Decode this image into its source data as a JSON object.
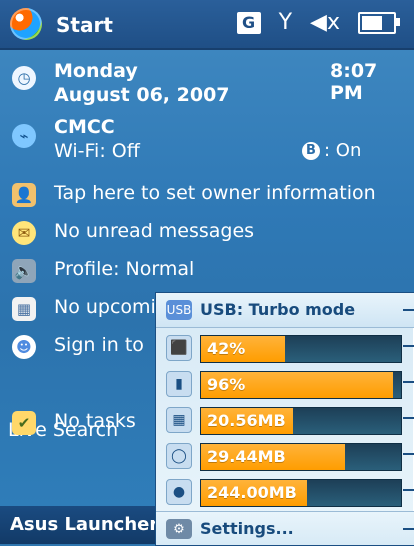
{
  "topbar": {
    "start_label": "Start",
    "status": {
      "g_label": "G",
      "antenna_glyph": "Y",
      "volume_glyph": "◀x",
      "battery_level": 0.75
    }
  },
  "today": {
    "date": {
      "day": "Monday",
      "date": "August 06, 2007",
      "time": "8:07 PM"
    },
    "network": {
      "carrier": "CMCC",
      "wifi": "Wi-Fi: Off",
      "bt": ": On",
      "bt_glyph": "B"
    },
    "owner": "Tap here to set owner information",
    "messages": "No unread messages",
    "profile": "Profile: Normal",
    "calendar": "No upcomi",
    "messenger": "Sign in to",
    "live_search": "Live Search",
    "tasks": "No tasks"
  },
  "panel": {
    "usb_label": "USB: Turbo mode",
    "rows": [
      {
        "label": "42%",
        "fill": 0.42,
        "icon": "cpu-icon",
        "glyph": "⬛"
      },
      {
        "label": "96%",
        "fill": 0.96,
        "icon": "battery-status-icon",
        "glyph": "▮"
      },
      {
        "label": "20.56MB",
        "fill": 0.46,
        "icon": "ram-icon",
        "glyph": "▦"
      },
      {
        "label": "29.44MB",
        "fill": 0.72,
        "icon": "storage-icon",
        "glyph": "◯"
      },
      {
        "label": "244.00MB",
        "fill": 0.53,
        "icon": "card-icon",
        "glyph": "●"
      }
    ],
    "settings_label": "Settings..."
  },
  "bottombar": {
    "launcher_label": "Asus Launcher"
  },
  "colors": {
    "accent": "#2f77b0",
    "bar_fill": "#ff9d00",
    "bar_bg": "#1d3f57"
  }
}
